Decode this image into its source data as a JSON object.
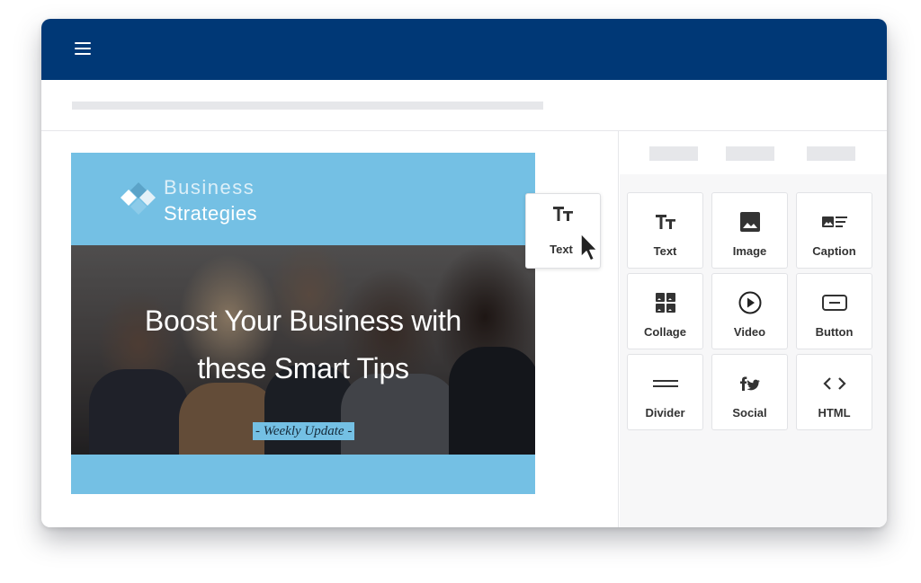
{
  "app": {
    "topbar_color": "#003876",
    "menu_icon": "hamburger-menu-icon"
  },
  "email": {
    "brand_color": "#74c0e4",
    "logo": {
      "line1": "Business",
      "line2": "Strategies",
      "icon": "diamond-logo-icon"
    },
    "hero": {
      "title_line1": "Boost Your Business with",
      "title_line2": "these Smart Tips",
      "badge": "- Weekly Update -"
    }
  },
  "drag_preview": {
    "label": "Text",
    "icon": "text-format-icon"
  },
  "panel": {
    "blocks": [
      {
        "label": "Text",
        "icon": "text-format-icon"
      },
      {
        "label": "Image",
        "icon": "image-icon"
      },
      {
        "label": "Caption",
        "icon": "caption-icon"
      },
      {
        "label": "Collage",
        "icon": "collage-icon"
      },
      {
        "label": "Video",
        "icon": "play-circle-icon"
      },
      {
        "label": "Button",
        "icon": "button-icon"
      },
      {
        "label": "Divider",
        "icon": "divider-icon"
      },
      {
        "label": "Social",
        "icon": "social-icon"
      },
      {
        "label": "HTML",
        "icon": "code-icon"
      }
    ]
  }
}
